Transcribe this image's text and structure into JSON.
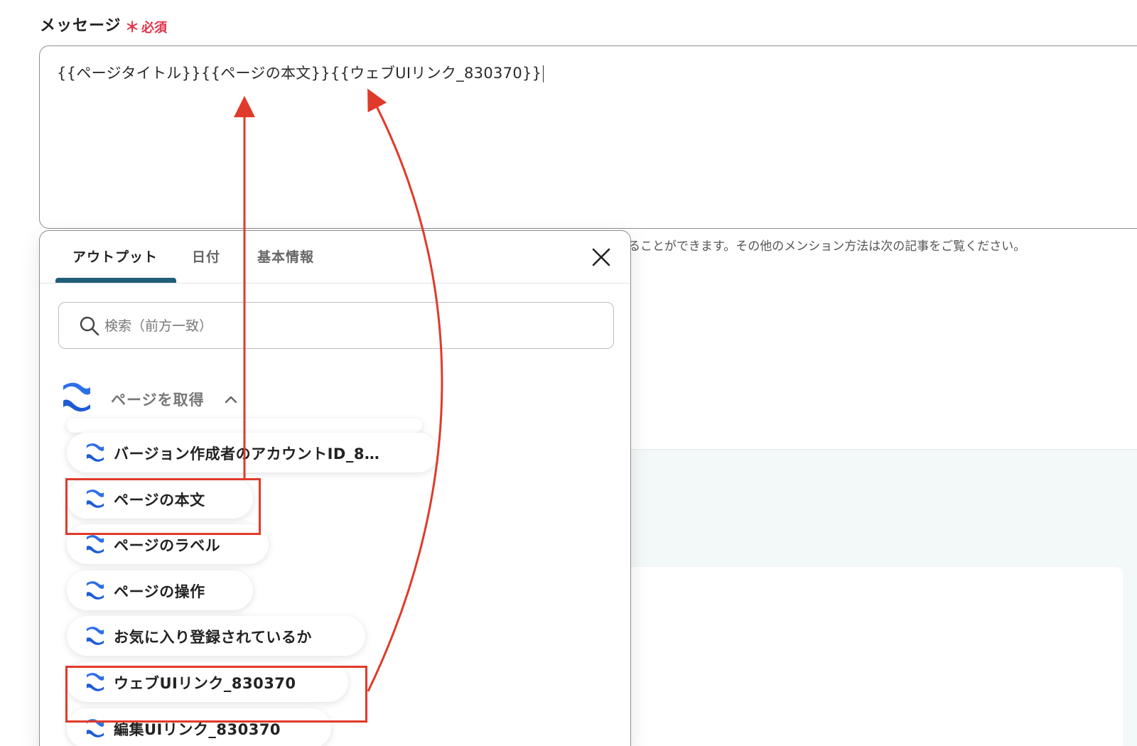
{
  "field": {
    "label": "メッセージ",
    "required_star": "＊",
    "required_text": "必須",
    "value": "{{ページタイトル}}{{ページの本文}}{{ウェブUIリンク_830370}}"
  },
  "helper_text": "ることができます。その他のメンション方法は次の記事をご覧ください。",
  "popup": {
    "tabs": [
      {
        "label": "アウトプット",
        "active": true
      },
      {
        "label": "日付",
        "active": false
      },
      {
        "label": "基本情報",
        "active": false
      }
    ],
    "close_icon": "close-icon",
    "search": {
      "placeholder": "検索（前方一致）",
      "value": ""
    },
    "group": {
      "title": "ページを取得",
      "expanded": true,
      "icon": "confluence-icon"
    },
    "items": [
      {
        "label": "バージョン作成者のアカウントID_8…",
        "highlighted": false
      },
      {
        "label": "ページの本文",
        "highlighted": true
      },
      {
        "label": "ページのラベル",
        "highlighted": false
      },
      {
        "label": "ページの操作",
        "highlighted": false
      },
      {
        "label": "お気に入り登録されているか",
        "highlighted": false
      },
      {
        "label": "ウェブUIリンク_830370",
        "highlighted": true
      },
      {
        "label": "編集UIリンク_830370",
        "highlighted": false
      }
    ]
  },
  "colors": {
    "accent_tab": "#1f5e78",
    "required": "#e0334a",
    "annotation": "#e03a2a",
    "confluence_blue": "#2c6fe8"
  }
}
